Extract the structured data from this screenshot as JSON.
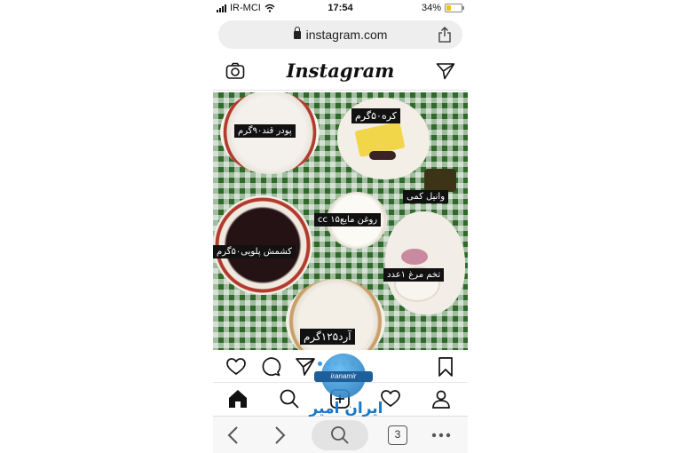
{
  "status_bar": {
    "carrier": "IR-MCI",
    "time": "17:54",
    "battery_percent": "34%",
    "battery_level": 0.34
  },
  "browser": {
    "url": "instagram.com",
    "tab_count": "3"
  },
  "instagram": {
    "logo": "Instagram",
    "carousel_total": 5,
    "carousel_active": 1
  },
  "post": {
    "labels": {
      "powdered_sugar": "پودر قند۹۰گرم",
      "butter": "کره۵۰گرم",
      "vanilla": "وانیل کمی",
      "oil": "روغن مایع۱۵ cc",
      "raisins": "کشمش پلویی۵۰گرم",
      "eggs": "تخم مرغ ۱عدد",
      "flour": "آرد۱۲۵گرم"
    }
  },
  "watermark": {
    "latin": "iranamir",
    "persian": "ایران امیر"
  },
  "colors": {
    "accent": "#3897f0",
    "gingham_green": "#2f6a2a",
    "watermark_blue": "#1a78c8"
  },
  "icons": [
    "signal-icon",
    "wifi-icon",
    "battery-icon",
    "lock-icon",
    "share-icon",
    "camera-icon",
    "direct-icon",
    "heart-icon",
    "comment-icon",
    "send-icon",
    "bookmark-icon",
    "home-icon",
    "search-icon",
    "add-icon",
    "activity-icon",
    "profile-icon",
    "back-icon",
    "forward-icon",
    "more-icon"
  ]
}
